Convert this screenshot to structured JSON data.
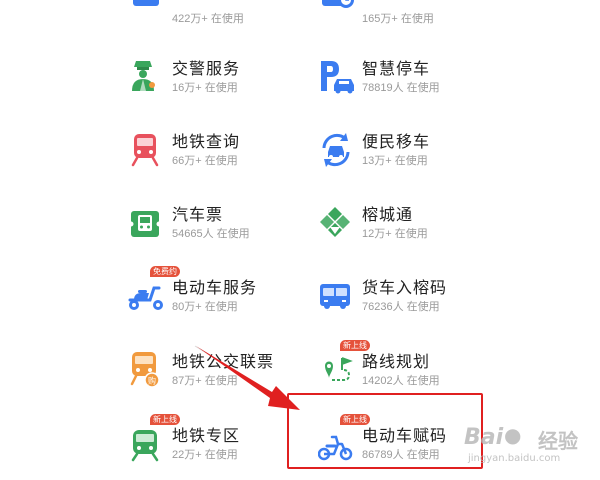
{
  "services": [
    {
      "id": "bus-top",
      "title": "",
      "sub": "422万+ 在使用",
      "icon": "bus-icon",
      "badge": ""
    },
    {
      "id": "parking-timer-top",
      "title": "",
      "sub": "165万+ 在使用",
      "icon": "car-clock-icon",
      "badge": ""
    },
    {
      "id": "traffic-police",
      "title": "交警服务",
      "sub": "16万+ 在使用",
      "icon": "traffic-police-icon",
      "badge": ""
    },
    {
      "id": "smart-parking",
      "title": "智慧停车",
      "sub": "78819人 在使用",
      "icon": "parking-icon",
      "badge": ""
    },
    {
      "id": "metro-query",
      "title": "地铁查询",
      "sub": "66万+ 在使用",
      "icon": "metro-train-icon",
      "badge": ""
    },
    {
      "id": "car-move",
      "title": "便民移车",
      "sub": "13万+ 在使用",
      "icon": "car-move-icon",
      "badge": ""
    },
    {
      "id": "bus-ticket",
      "title": "汽车票",
      "sub": "54665人 在使用",
      "icon": "bus-ticket-icon",
      "badge": ""
    },
    {
      "id": "rongcheng-pass",
      "title": "榕城通",
      "sub": "12万+ 在使用",
      "icon": "rongcheng-pass-icon",
      "badge": ""
    },
    {
      "id": "ebike-service",
      "title": "电动车服务",
      "sub": "80万+ 在使用",
      "icon": "scooter-icon",
      "badge": "免费约"
    },
    {
      "id": "truck-code",
      "title": "货车入榕码",
      "sub": "76236人 在使用",
      "icon": "truck-icon",
      "badge": ""
    },
    {
      "id": "metro-bus-ticket",
      "title": "地铁公交联票",
      "sub": "87万+ 在使用",
      "icon": "metro-ticket-icon",
      "badge": ""
    },
    {
      "id": "route-plan",
      "title": "路线规划",
      "sub": "14202人 在使用",
      "icon": "route-pin-icon",
      "badge": "新上线"
    },
    {
      "id": "metro-zone",
      "title": "地铁专区",
      "sub": "22万+ 在使用",
      "icon": "metro-zone-icon",
      "badge": "新上线"
    },
    {
      "id": "ebike-code",
      "title": "电动车赋码",
      "sub": "86789人 在使用",
      "icon": "ebike-code-icon",
      "badge": "新上线"
    }
  ],
  "watermark": {
    "brand_left": "Bai",
    "brand_right": "经验",
    "url": "jingyan.baidu.com"
  },
  "colors": {
    "accent_blue": "#3b7cf0",
    "green": "#3aa65c",
    "red": "#e8515d",
    "orange": "#f19a3e",
    "annotation_red": "#e02020"
  }
}
